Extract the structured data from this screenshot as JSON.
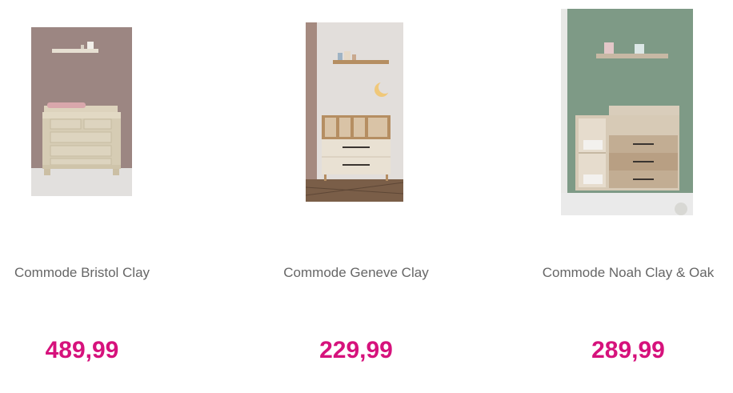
{
  "theme": {
    "price_color": "#d6127c",
    "name_color": "#666666"
  },
  "products": [
    {
      "name": "Commode Bristol Clay",
      "price": "489,99",
      "image": "changing-dresser-photo"
    },
    {
      "name": "Commode Geneve Clay",
      "price": "229,99",
      "image": "changing-dresser-photo"
    },
    {
      "name": "Commode Noah Clay & Oak",
      "price": "289,99",
      "image": "changing-dresser-photo"
    }
  ]
}
